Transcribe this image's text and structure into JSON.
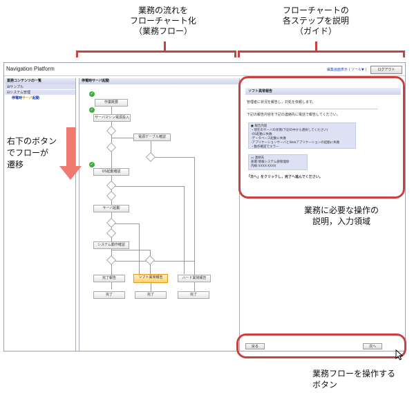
{
  "annotations": {
    "top_left": [
      "業務の流れを",
      "フローチャート化",
      "（業務フロー）"
    ],
    "top_right": [
      "フローチャートの",
      "各ステップを説明",
      "（ガイド）"
    ],
    "left_arrow": [
      "右下のボタン",
      "でフローが",
      "遷移"
    ],
    "right_mid": [
      "業務に必要な操作の",
      "説明，入力領域"
    ],
    "bottom": [
      "業務フローを操作する",
      "ボタン"
    ]
  },
  "window": {
    "app_title": "Navigation Platform",
    "header_links": "編集画面表示 | ツール▼ |",
    "logout": "ログアウト"
  },
  "left_pane": {
    "title": "業務コンテンツの一覧",
    "items": [
      "⊞サンプル",
      "⊟システム管理"
    ],
    "selected_prefix": "停電時",
    "selected_highlight": "サーバ",
    "selected_suffix": "起動"
  },
  "flow_pane": {
    "title": "停電時サーバ起動",
    "nodes": {
      "start": "作業概要",
      "power_on": "サーバマシン電源投入",
      "cable_check": "電源ケーブル確認",
      "os_check": "OS起動確認",
      "server_start": "サーバ起動",
      "system_check": "システム動作確認",
      "done_report": "完了報告",
      "soft_error": "ソフト異常報告",
      "hard_error": "ハード異常報告",
      "end1": "完了",
      "end2": "完了",
      "end3": "完了"
    }
  },
  "guide_pane": {
    "title": "ソフト異常報告",
    "line1": "管理者に状況を報告し，対処を依頼します。",
    "line2": "下記の報告内容を下記の連絡先に電話で報告してください。",
    "report_title": "報告内容",
    "report_lines": [
      "・現在のサーバの状態(下記の中から選択してください)",
      "-OS起動に失敗",
      "-データベース起動に失敗",
      "-アプリケーションサーバとWebアプリケーションの起動に失敗",
      "・動作確認でエラー"
    ],
    "contact_title": "連絡先",
    "contact_lines": [
      "部署:情報システム部管理係",
      "内線:XXXX-XXXX"
    ],
    "next_instruction": "「次へ」をクリックし，完了へ進んでください。",
    "back_button": "戻る",
    "next_button": "次へ"
  },
  "colors": {
    "annotation_red": "#c94040",
    "arrow_fill": "#f07a70",
    "active_node": "#ffcf6a"
  }
}
